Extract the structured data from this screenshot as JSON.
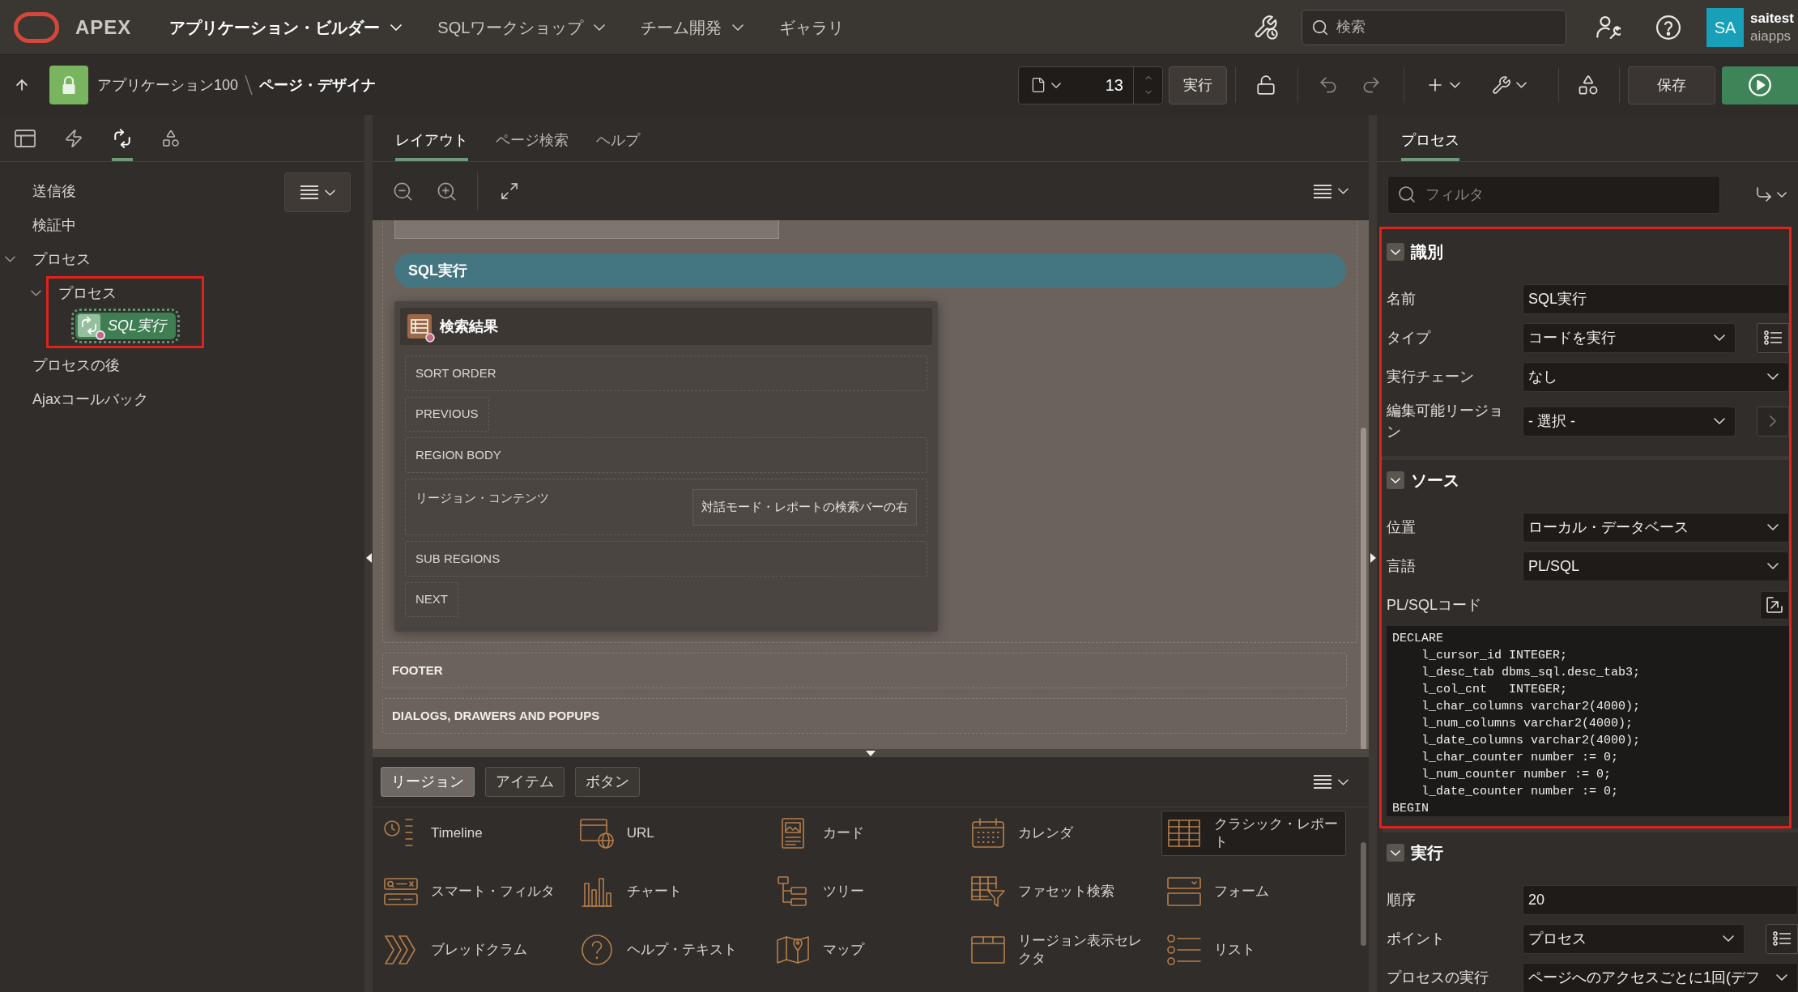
{
  "header": {
    "logo_text": "APEX",
    "menus": [
      {
        "label": "アプリケーション・ビルダー",
        "selected": true,
        "has_menu": true
      },
      {
        "label": "SQLワークショップ",
        "selected": false,
        "has_menu": true
      },
      {
        "label": "チーム開発",
        "selected": false,
        "has_menu": true
      },
      {
        "label": "ギャラリ",
        "selected": false,
        "has_menu": false
      }
    ],
    "search": {
      "placeholder": "検索"
    },
    "user": {
      "initials": "SA",
      "name": "saitest",
      "workspace": "aiapps"
    }
  },
  "toolbar": {
    "breadcrumb": [
      {
        "label": "アプリケーション100",
        "current": false
      },
      {
        "label": "ページ・デザイナ",
        "current": true
      }
    ],
    "page_number": "13",
    "go_button": "実行",
    "save_button": "保存"
  },
  "left_panel": {
    "tabs": [
      {
        "selected": false
      },
      {
        "selected": false
      },
      {
        "selected": true
      },
      {
        "selected": false
      }
    ],
    "tree": [
      {
        "label": "送信後",
        "kind": "group",
        "selected": false
      },
      {
        "label": "検証中",
        "kind": "group",
        "selected": false
      },
      {
        "label": "プロセス",
        "kind": "group",
        "selected": false,
        "expanded": true,
        "children": [
          {
            "label": "プロセス",
            "kind": "group",
            "selected": false,
            "expanded": true,
            "highlighted": true,
            "children": [
              {
                "label": "SQL実行",
                "kind": "process",
                "selected": true
              }
            ]
          }
        ]
      },
      {
        "label": "プロセスの後",
        "kind": "group",
        "selected": false
      },
      {
        "label": "Ajaxコールバック",
        "kind": "group",
        "selected": false
      }
    ]
  },
  "center": {
    "tabs": [
      {
        "label": "レイアウト",
        "selected": true
      },
      {
        "label": "ページ検索",
        "selected": false
      },
      {
        "label": "ヘルプ",
        "selected": false
      }
    ],
    "canvas": {
      "process_bar": "SQL実行",
      "region": {
        "title": "検索結果",
        "slots": [
          {
            "label": "SORT ORDER",
            "kind": "wide"
          },
          {
            "label": "PREVIOUS",
            "kind": "compact"
          },
          {
            "label": "REGION BODY",
            "kind": "wide"
          },
          {
            "label": "リージョン・コンテンツ",
            "kind": "content",
            "item": "対話モード・レポートの検索バーの右"
          },
          {
            "label": "SUB REGIONS",
            "kind": "wide"
          },
          {
            "label": "NEXT",
            "kind": "compact"
          }
        ]
      },
      "page_regions": [
        "FOOTER",
        "DIALOGS, DRAWERS AND POPUPS"
      ]
    },
    "gallery": {
      "tabs": [
        {
          "label": "リージョン",
          "selected": true
        },
        {
          "label": "アイテム",
          "selected": false
        },
        {
          "label": "ボタン",
          "selected": false
        }
      ],
      "items": [
        {
          "label": "Timeline",
          "selected": false
        },
        {
          "label": "URL",
          "selected": false
        },
        {
          "label": "カード",
          "selected": false
        },
        {
          "label": "カレンダ",
          "selected": false
        },
        {
          "label": "クラシック・レポート",
          "selected": true
        },
        {
          "label": "スマート・フィルタ",
          "selected": false
        },
        {
          "label": "チャート",
          "selected": false
        },
        {
          "label": "ツリー",
          "selected": false
        },
        {
          "label": "ファセット検索",
          "selected": false
        },
        {
          "label": "フォーム",
          "selected": false
        },
        {
          "label": "ブレッドクラム",
          "selected": false
        },
        {
          "label": "ヘルプ・テキスト",
          "selected": false
        },
        {
          "label": "マップ",
          "selected": false
        },
        {
          "label": "リージョン表示セレクタ",
          "selected": false
        },
        {
          "label": "リスト",
          "selected": false
        }
      ]
    }
  },
  "right_panel": {
    "tabs": [
      {
        "label": "プロセス",
        "selected": true
      }
    ],
    "filter": {
      "placeholder": "フィルタ"
    },
    "sections": [
      {
        "title": "識別",
        "expanded": true,
        "highlighted": true,
        "properties": [
          {
            "label": "名前",
            "kind": "text",
            "value": "SQL実行"
          },
          {
            "label": "タイプ",
            "kind": "select",
            "value": "コードを実行",
            "addon": {
              "kind": "list"
            }
          },
          {
            "label": "実行チェーン",
            "kind": "select",
            "value": "なし"
          },
          {
            "label": "編集可能リージョン",
            "kind": "select",
            "value": "- 選択 -",
            "addon": {
              "kind": "next"
            }
          }
        ]
      },
      {
        "title": "ソース",
        "expanded": true,
        "highlighted": true,
        "properties": [
          {
            "label": "位置",
            "kind": "select",
            "value": "ローカル・データベース"
          },
          {
            "label": "言語",
            "kind": "select",
            "value": "PL/SQL"
          },
          {
            "label": "PL/SQLコード",
            "kind": "code",
            "lines": [
              "DECLARE",
              "    l_cursor_id INTEGER;",
              "    l_desc_tab dbms_sql.desc_tab3;",
              "    l_col_cnt   INTEGER;",
              "    l_char_columns varchar2(4000);",
              "    l_num_columns varchar2(4000);",
              "    l_date_columns varchar2(4000);",
              "    l_char_counter number := 0;",
              "    l_num_counter number := 0;",
              "    l_date_counter number := 0;",
              "BEGIN"
            ]
          }
        ]
      },
      {
        "title": "実行",
        "expanded": true,
        "highlighted": false,
        "properties": [
          {
            "label": "順序",
            "kind": "text",
            "value": "20"
          },
          {
            "label": "ポイント",
            "kind": "select",
            "value": "プロセス",
            "addon": {
              "kind": "list"
            }
          },
          {
            "label": "プロセスの実行",
            "kind": "select",
            "value": "ページへのアクセスごとに1回(デフ"
          }
        ]
      }
    ]
  }
}
